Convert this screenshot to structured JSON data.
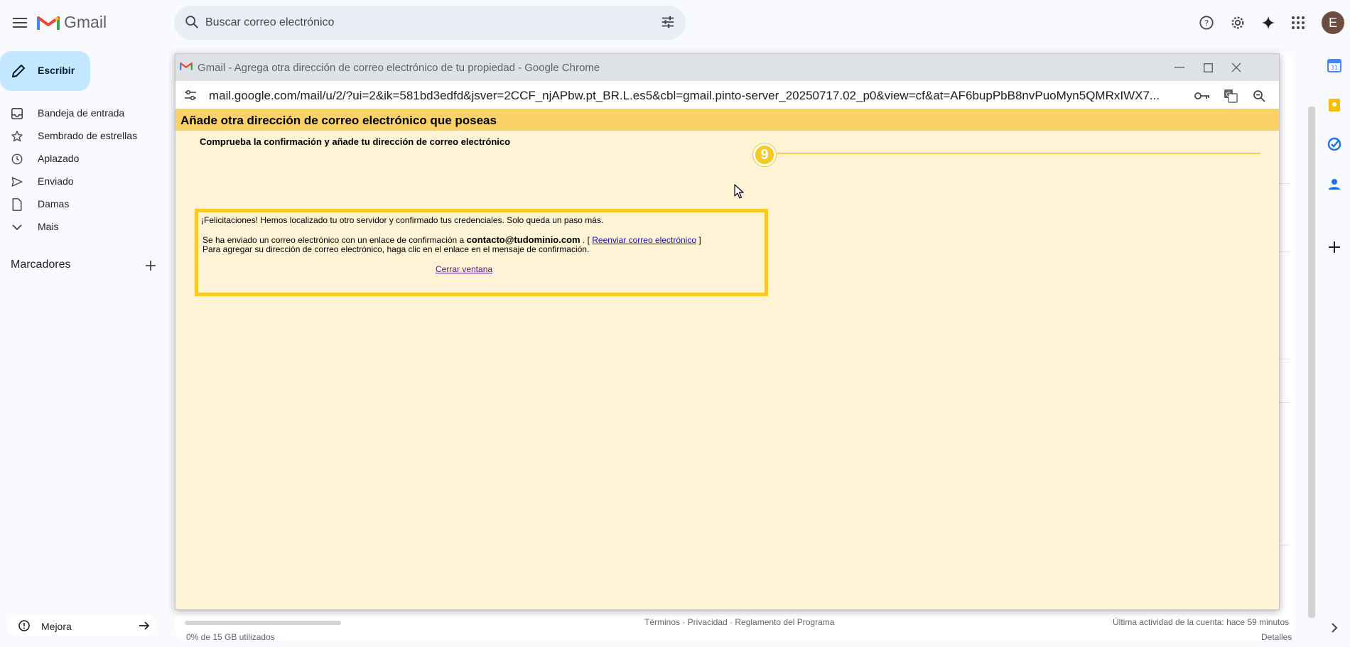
{
  "app": {
    "logo_text": "Gmail",
    "search_placeholder": "Buscar correo electrónico",
    "avatar_initial": "E"
  },
  "compose": {
    "label": "Escribir"
  },
  "nav": {
    "items": [
      {
        "label": "Bandeja de entrada",
        "icon": "inbox-icon"
      },
      {
        "label": "Sembrado de estrellas",
        "icon": "star-icon"
      },
      {
        "label": "Aplazado",
        "icon": "clock-icon"
      },
      {
        "label": "Enviado",
        "icon": "send-icon"
      },
      {
        "label": "Damas",
        "icon": "draft-icon"
      },
      {
        "label": "Mais",
        "icon": "chevron-down-icon"
      }
    ],
    "labels_title": "Marcadores",
    "upgrade_label": "Mejora"
  },
  "footer": {
    "links": "Términos · Privacidad · Reglamento del Programa",
    "activity": "Última actividad de la cuenta: hace 59 minutos",
    "storage": "0% de 15 GB utilizados",
    "details": "Detalles"
  },
  "popup": {
    "window_title": "Gmail - Agrega otra dirección de correo electrónico de tu propiedad - Google Chrome",
    "url": "mail.google.com/mail/u/2/?ui=2&ik=581bd3edfd&jsver=2CCF_njAPbw.pt_BR.L.es5&cbl=gmail.pinto-server_20250717.02_p0&view=cf&at=AF6bupPbB8nvPuoMyn5QMRxIWX7...",
    "heading": "Añade otra dirección de correo electrónico que poseas",
    "subheading": "Comprueba la confirmación y añade tu dirección de correo electrónico",
    "congrats": "¡Felicitaciones! Hemos localizado tu otro servidor y confirmado tus credenciales. Solo queda un paso más.",
    "sent_prefix": "Se ha enviado un correo electrónico con un enlace de confirmación a ",
    "email": "contacto@tudominio.com",
    "bracket_open": " . [ ",
    "resend_link": "Reenviar correo electrónico",
    "bracket_close": " ]",
    "instruction": "Para agregar su dirección de correo electrónico, haga clic en el enlace en el mensaje de confirmación.",
    "close_link": "Cerrar ventana",
    "step_number": "9"
  },
  "colors": {
    "accent_yellow": "#f6c925",
    "heading_bg": "#fad165",
    "body_bg": "#fef3d4",
    "compose_bg": "#c2e7ff"
  }
}
